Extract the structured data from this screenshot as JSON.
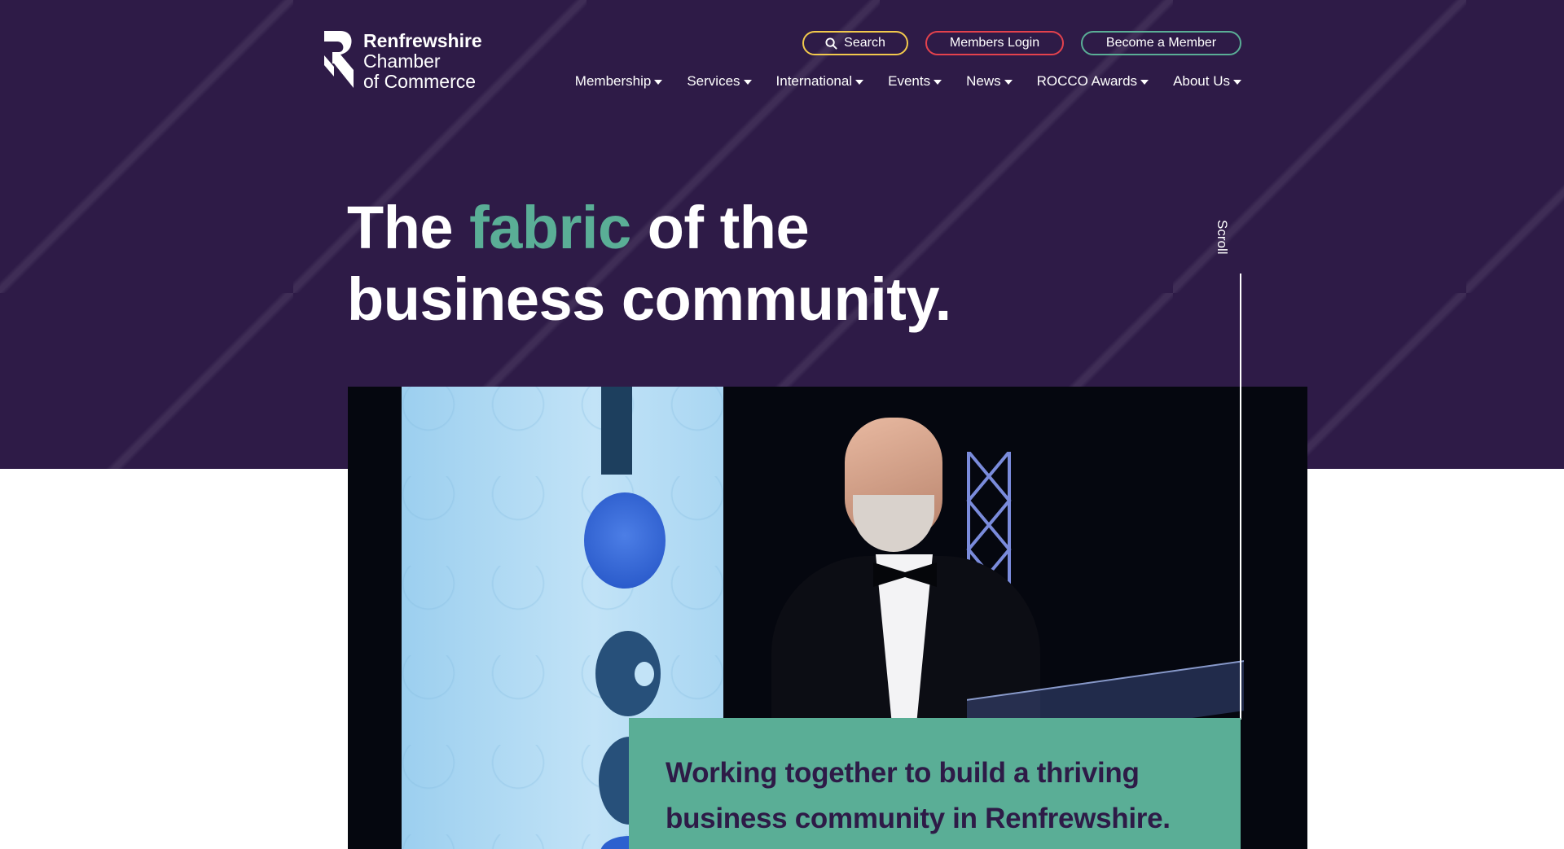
{
  "logo": {
    "line1": "Renfrewshire",
    "line2": "Chamber",
    "line3": "of Commerce"
  },
  "header": {
    "search_label": "Search",
    "login_label": "Members Login",
    "become_member_label": "Become a Member"
  },
  "nav": {
    "items": [
      {
        "label": "Membership"
      },
      {
        "label": "Services"
      },
      {
        "label": "International"
      },
      {
        "label": "Events"
      },
      {
        "label": "News"
      },
      {
        "label": "ROCCO Awards"
      },
      {
        "label": "About Us"
      }
    ]
  },
  "hero": {
    "headline_part1": "The ",
    "headline_accent": "fabric",
    "headline_part2": " of the",
    "headline_line2": "business community.",
    "scroll_label": "Scroll",
    "tagline_line1": "Working together to build a thriving",
    "tagline_line2": "business community in Renfrewshire."
  },
  "colors": {
    "brand_purple": "#2e1b47",
    "accent_green": "#5aae96",
    "search_yellow": "#f2c94c",
    "login_red": "#e4424d"
  },
  "icons": {
    "search": "search-icon",
    "dropdown": "caret-down-icon"
  }
}
